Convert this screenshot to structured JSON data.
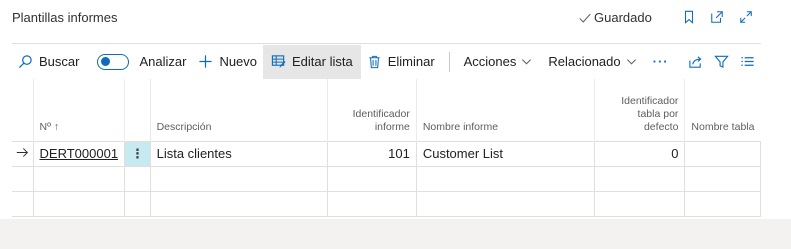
{
  "page": {
    "title": "Plantillas informes",
    "saved_status": "Guardado"
  },
  "toolbar": {
    "search_label": "Buscar",
    "analyze_label": "Analizar",
    "new_label": "Nuevo",
    "edit_list_label": "Editar lista",
    "delete_label": "Eliminar",
    "actions_label": "Acciones",
    "related_label": "Relacionado",
    "more_label": "···"
  },
  "table": {
    "headers": {
      "no": "Nº ↑",
      "description": "Descripción",
      "report_id": "Identificador informe",
      "report_name": "Nombre informe",
      "default_table_id": "Identificador tabla por defecto",
      "table_name": "Nombre tabla"
    },
    "rows": [
      {
        "no": "DERT000001",
        "menu": "⋮",
        "description": "Lista clientes",
        "report_id": "101",
        "report_name": "Customer List",
        "default_table_id": "0",
        "table_name": ""
      }
    ]
  },
  "colors": {
    "accent": "#0f6cbd",
    "selected_cell": "#c7eaf0",
    "footer_band": "#f3f2f1"
  }
}
